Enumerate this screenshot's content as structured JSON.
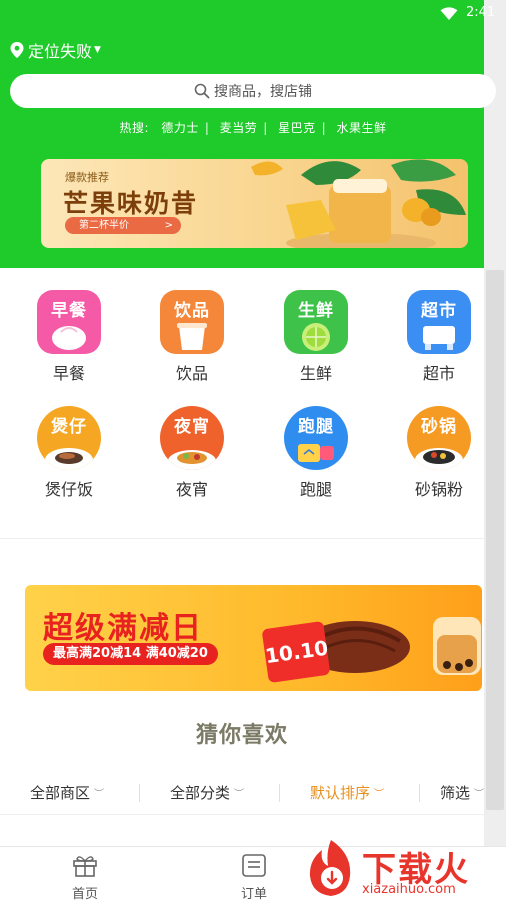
{
  "status_bar": {
    "time": "2:41"
  },
  "header": {
    "location": "定位失败",
    "search_placeholder": "搜商品，搜店铺",
    "hot_label": "热搜:",
    "hot_keywords": [
      "德力士",
      "麦当劳",
      "星巴克",
      "水果生鲜"
    ]
  },
  "promo_banner": {
    "tag": "爆款推荐",
    "title": "芒果味奶昔",
    "pill": "第二杯半价"
  },
  "categories": [
    {
      "icon_text": "早餐",
      "label": "早餐",
      "color": "#f45aa6"
    },
    {
      "icon_text": "饮品",
      "label": "饮品",
      "color": "#f5873a"
    },
    {
      "icon_text": "生鲜",
      "label": "生鲜",
      "color": "#3fc24a"
    },
    {
      "icon_text": "超市",
      "label": "超市",
      "color": "#3b8ef2"
    },
    {
      "icon_text": "煲仔",
      "label": "煲仔饭",
      "color": "#f5a623"
    },
    {
      "icon_text": "夜宵",
      "label": "夜宵",
      "color": "#f0622b"
    },
    {
      "icon_text": "跑腿",
      "label": "跑腿",
      "color": "#2f8df0"
    },
    {
      "icon_text": "砂锅",
      "label": "砂锅粉",
      "color": "#f59a22"
    }
  ],
  "sale_banner": {
    "title": "超级满减日",
    "subtitle": "最高满20减14 满40减20",
    "badge": "10.10"
  },
  "section_title": "猜你喜欢",
  "filters": [
    {
      "label": "全部商区",
      "active": false
    },
    {
      "label": "全部分类",
      "active": false
    },
    {
      "label": "默认排序",
      "active": true
    },
    {
      "label": "筛选",
      "active": false
    }
  ],
  "bottom_nav": [
    {
      "label": "首页",
      "icon": "gift-icon"
    },
    {
      "label": "订单",
      "icon": "order-icon"
    }
  ],
  "watermark": {
    "text": "下载火",
    "url": "xiazaihuo.com"
  },
  "colors": {
    "header_green": "#1fcb2a",
    "accent_orange": "#e8901e",
    "sale_red": "#e8231f"
  }
}
